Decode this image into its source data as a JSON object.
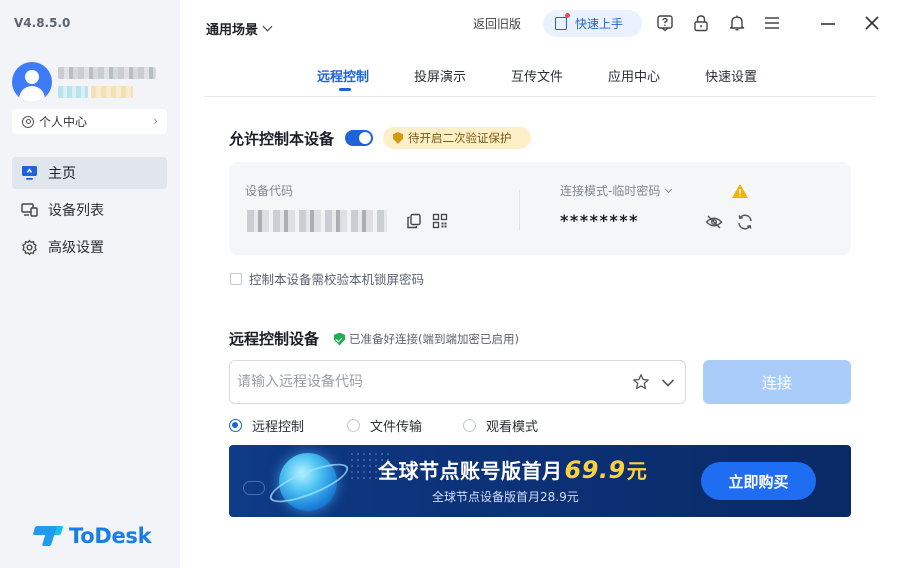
{
  "app": {
    "version": "V4.8.5.0",
    "logo_text": "ToDesk"
  },
  "sidebar": {
    "personal_center": "个人中心",
    "items": [
      {
        "label": "主页",
        "icon": "monitor-icon",
        "active": true
      },
      {
        "label": "设备列表",
        "icon": "devices-icon",
        "active": false
      },
      {
        "label": "高级设置",
        "icon": "gear-icon",
        "active": false
      }
    ]
  },
  "header": {
    "scene": "通用场景",
    "old_version": "返回旧版",
    "quick_start": "快速上手"
  },
  "tabs": [
    {
      "label": "远程控制",
      "active": true
    },
    {
      "label": "投屏演示",
      "active": false
    },
    {
      "label": "互传文件",
      "active": false
    },
    {
      "label": "应用中心",
      "active": false
    },
    {
      "label": "快速设置",
      "active": false
    }
  ],
  "allow": {
    "title": "允许控制本设备",
    "toggle_on": true,
    "verify_badge": "待开启二次验证保护",
    "device_code_label": "设备代码",
    "mode_label": "连接模式-临时密码",
    "password": "********",
    "lock_checkbox_label": "控制本设备需校验本机锁屏密码"
  },
  "remote": {
    "title": "远程控制设备",
    "ready_text": "已准备好连接(端到端加密已启用)",
    "input_placeholder": "请输入远程设备代码",
    "input_value": "",
    "connect_label": "连接",
    "modes": [
      {
        "label": "远程控制",
        "checked": true
      },
      {
        "label": "文件传输",
        "checked": false
      },
      {
        "label": "观看模式",
        "checked": false
      }
    ]
  },
  "banner": {
    "title_prefix": "全球节点账号版首月",
    "price": "69.9",
    "unit": "元",
    "subtitle": "全球节点设备版首月28.9元",
    "buy_label": "立即购买"
  },
  "colors": {
    "accent": "#1f63d8",
    "connect_disabled": "#a9cdf8",
    "warning": "#f0b400",
    "ready_green": "#1fae55",
    "banner_bg": "#0c3278",
    "price_yellow": "#ffd23c"
  }
}
